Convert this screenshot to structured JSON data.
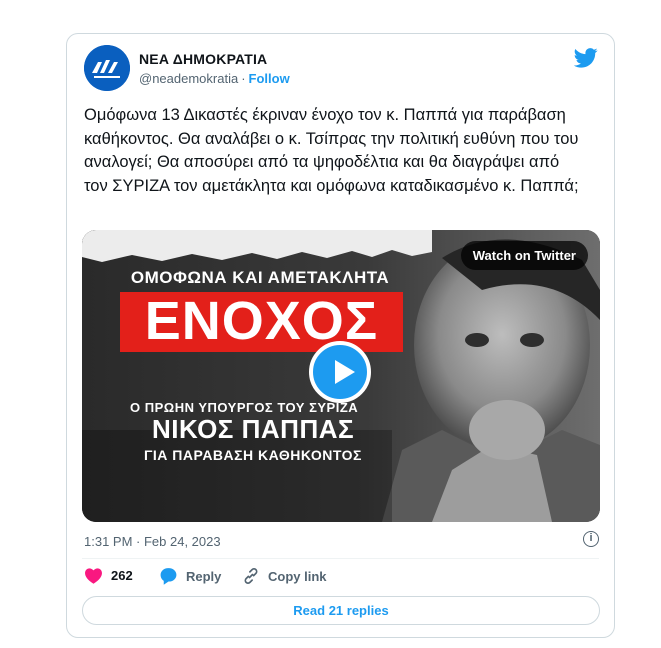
{
  "author": {
    "name": "ΝΕΑ ΔΗΜΟΚΡΑΤΙΑ",
    "handle": "@neademokratia",
    "separator": "·",
    "follow_label": "Follow"
  },
  "tweet": {
    "text": "Ομόφωνα 13 Δικαστές έκριναν ένοχο τον κ. Παππά για παράβαση καθήκοντος. Θα αναλάβει ο κ. Τσίπρας την πολιτική ευθύνη που του αναλογεί; Θα αποσύρει από τα ψηφοδέλτια και θα διαγράψει από τον ΣΥΡΙΖΑ τον αμετάκλητα και ομόφωνα καταδικασμένο κ. Παππά;",
    "timestamp": "1:31 PM · Feb 24, 2023"
  },
  "media": {
    "watch_label": "Watch on Twitter",
    "headline_top": "ΟΜΟΦΩΝΑ ΚΑΙ ΑΜΕΤΑΚΛΗΤΑ",
    "headline_main": "ΕΝΟΧΟΣ",
    "subtitle_1": "Ο ΠΡΩΗΝ ΥΠΟΥΡΓΟΣ ΤΟΥ ΣΥΡΙΖΑ",
    "subtitle_2": "ΝΙΚΟΣ ΠΑΠΠΑΣ",
    "subtitle_3": "ΓΙΑ ΠΑΡΑΒΑΣΗ ΚΑΘΗΚΟΝΤΟΣ",
    "play_icon": "play-icon"
  },
  "actions": {
    "like_count": "262",
    "reply_label": "Reply",
    "copy_link_label": "Copy link",
    "read_replies_label": "Read 21 replies",
    "info_glyph": "i"
  },
  "colors": {
    "accent": "#1d9bf0",
    "like": "#f91880",
    "headline_red": "#e3201a",
    "avatar_blue": "#0a5fbf"
  }
}
